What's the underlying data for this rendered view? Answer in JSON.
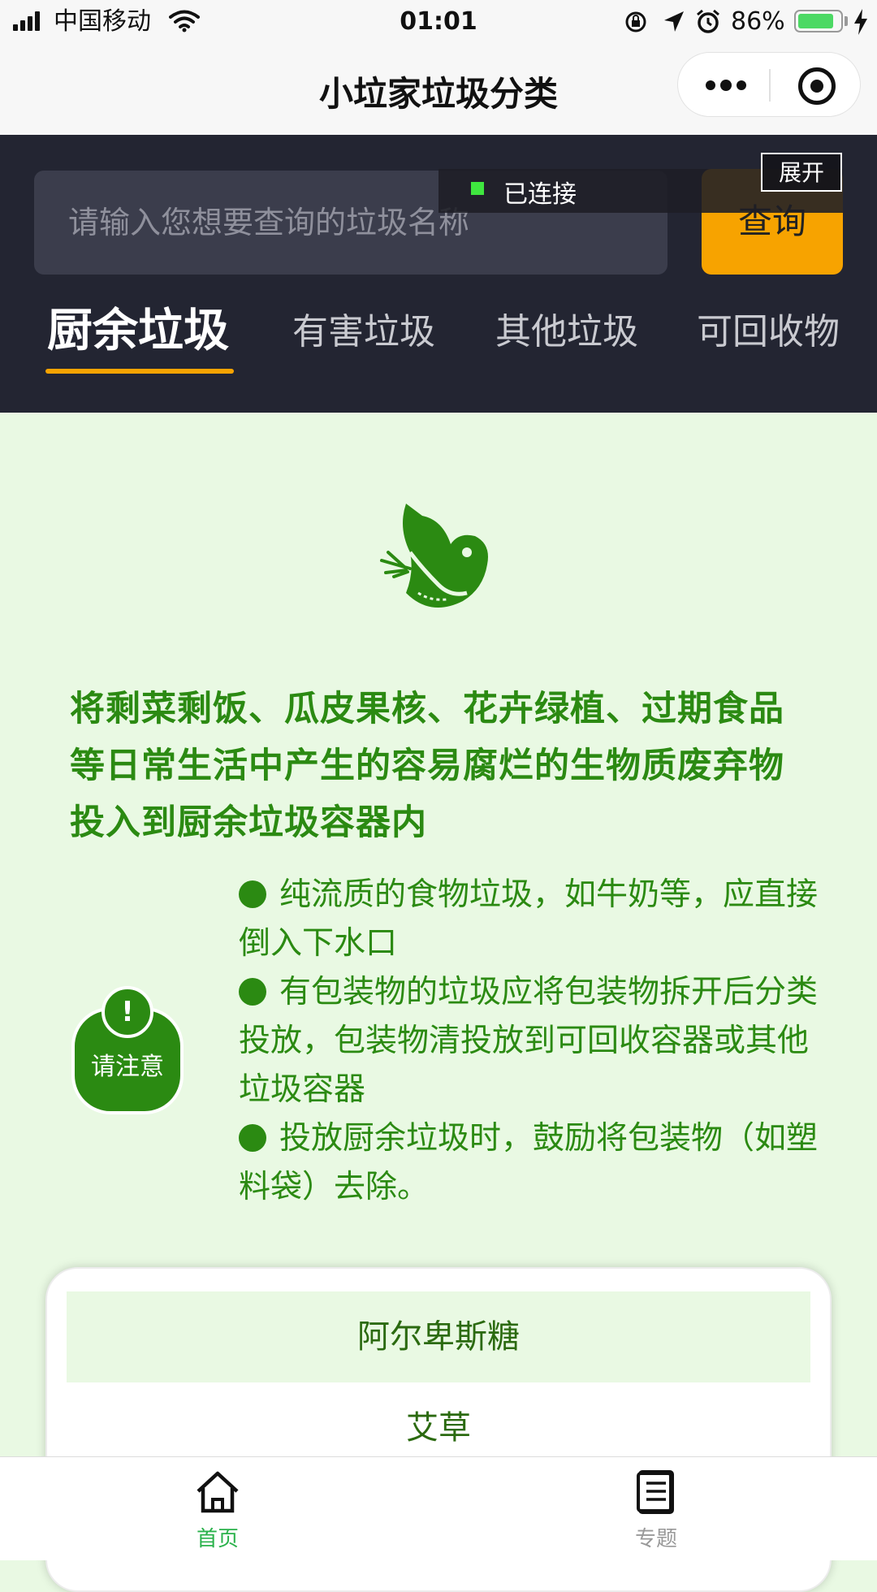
{
  "status_bar": {
    "carrier": "中国移动",
    "time": "01:01",
    "battery": "86%",
    "battery_level": 0.86
  },
  "nav": {
    "title": "小垃家垃圾分类"
  },
  "search": {
    "placeholder": "请输入您想要查询的垃圾名称",
    "button": "查询"
  },
  "connection": {
    "status": "已连接",
    "expand": "展开"
  },
  "tabs": [
    {
      "label": "厨余垃圾",
      "active": true
    },
    {
      "label": "有害垃圾",
      "active": false
    },
    {
      "label": "其他垃圾",
      "active": false
    },
    {
      "label": "可回收物",
      "active": false
    }
  ],
  "category": {
    "description": "将剩菜剩饭、瓜皮果核、花卉绿植、过期食品等日常生活中产生的容易腐烂的生物质废弃物投入到厨余垃圾容器内",
    "notice_mark": "!",
    "notice_label": "请注意",
    "notes": [
      "纯流质的食物垃圾，如牛奶等，应直接倒入下水口",
      "有包装物的垃圾应将包装物拆开后分类投放，包装物清投放到可回收容器或其他垃圾容器",
      "投放厨余垃圾时，鼓励将包装物（如塑料袋）去除。"
    ]
  },
  "items": [
    {
      "name": "阿尔卑斯糖"
    },
    {
      "name": "艾草"
    }
  ],
  "tabbar": [
    {
      "label": "首页",
      "icon": "home-icon",
      "active": true
    },
    {
      "label": "专题",
      "icon": "document-icon",
      "active": false
    }
  ],
  "colors": {
    "accent": "#f7a300",
    "primary_green": "#2b8a12",
    "header_bg": "#232532",
    "page_bg": "#e9f9e3",
    "tabbar_active": "#2bb24c"
  }
}
